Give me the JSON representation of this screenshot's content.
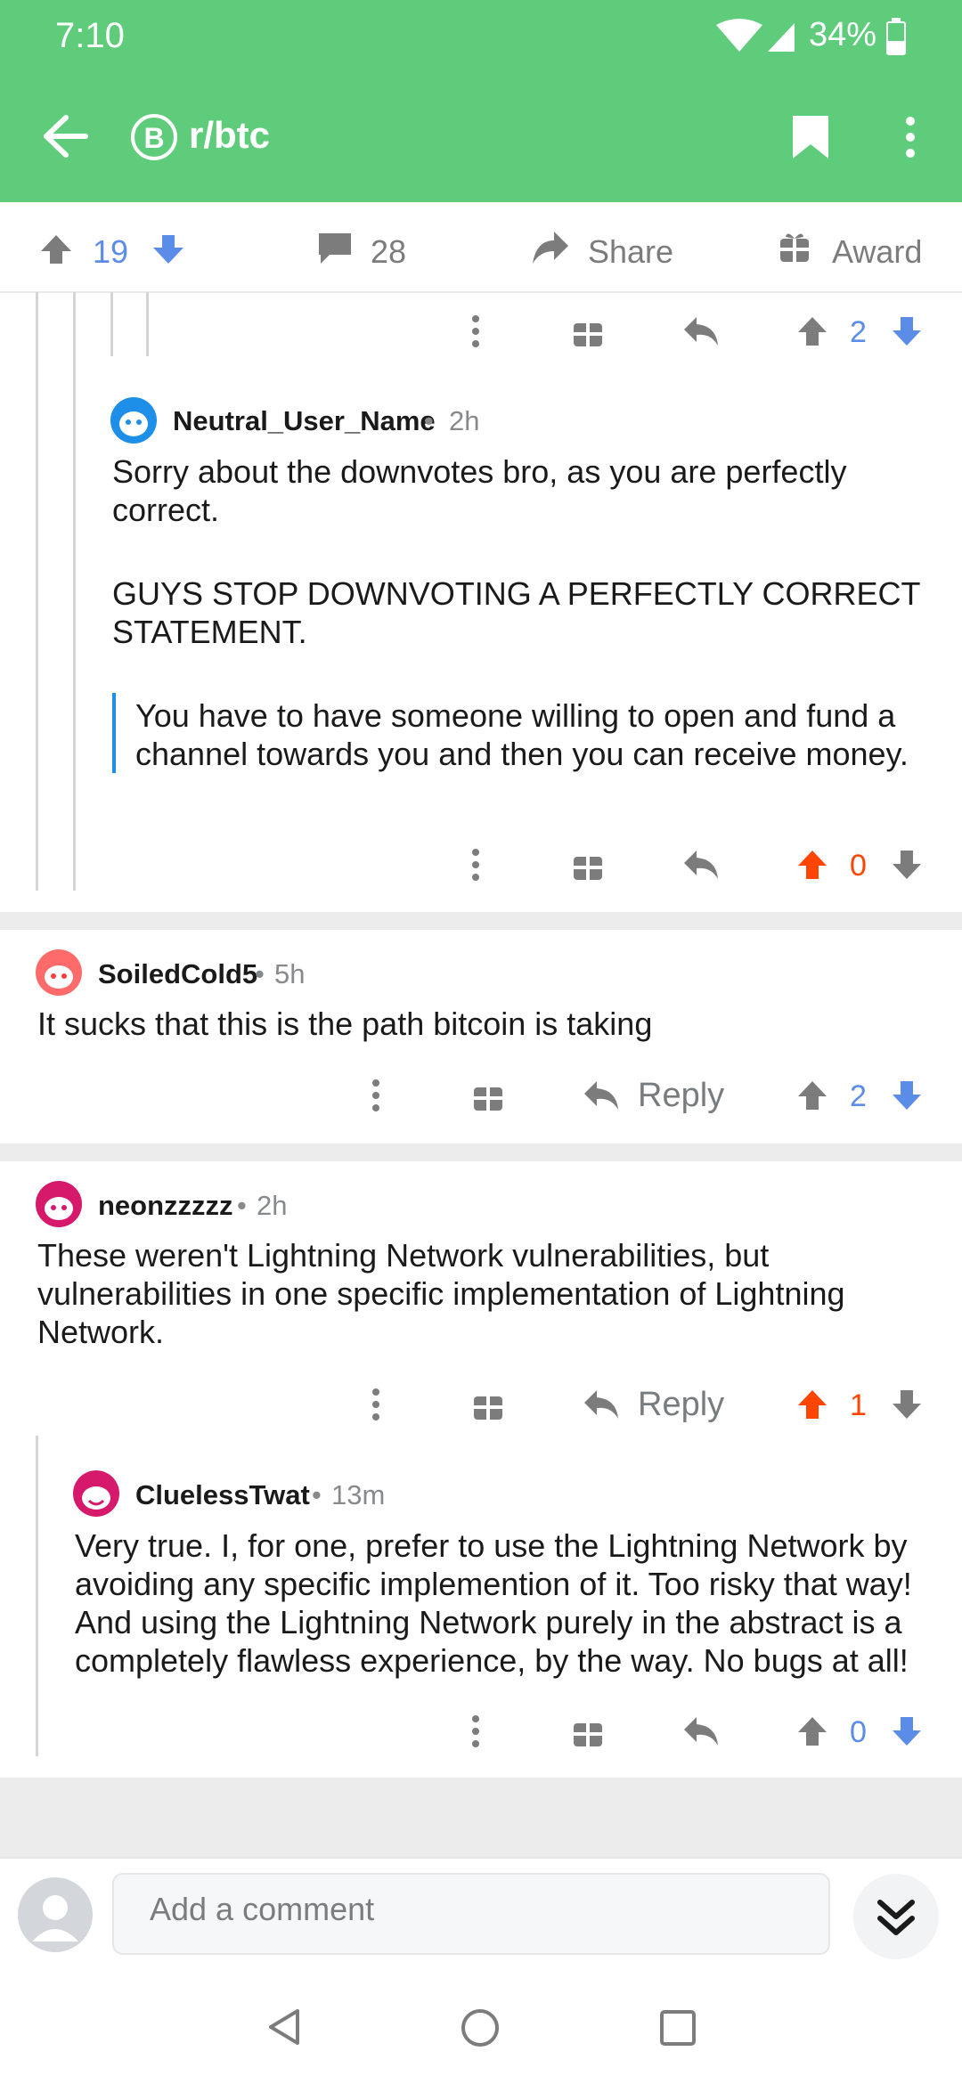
{
  "status": {
    "time": "7:10",
    "battery": "34%"
  },
  "header": {
    "subreddit": "r/btc",
    "subreddit_icon": "bitcoin-icon"
  },
  "votebar": {
    "upvotes": "19",
    "comments": "28",
    "share": "Share",
    "award": "Award"
  },
  "comments": [
    {
      "vote_count": "2"
    },
    {
      "author": "Neutral_User_Name",
      "age": "2h",
      "body_lines": [
        "Sorry about the downvotes bro, as you are perfectly",
        "correct."
      ],
      "body_lines2": [
        "GUYS STOP DOWNVOTING A PERFECTLY CORRECT",
        "STATEMENT."
      ],
      "quote_lines": [
        "You have to have someone willing to open and fund a",
        "channel towards you and then you can receive money."
      ],
      "vote_count": "0"
    },
    {
      "author": "SoiledCold5",
      "age": "5h",
      "body_lines": [
        "It sucks that this is the path bitcoin is taking"
      ],
      "reply": "Reply",
      "vote_count": "2"
    },
    {
      "author": "neonzzzzz",
      "age": "2h",
      "body_lines": [
        "These weren't Lightning Network vulnerabilities, but",
        "vulnerabilities in one specific implementation of Lightning",
        "Network."
      ],
      "reply": "Reply",
      "vote_count": "1"
    },
    {
      "author": "CluelessTwat",
      "age": "13m",
      "body_lines": [
        "Very true. I, for one, prefer to use the Lightning Network by",
        "avoiding any specific implemention of it. Too risky that way!",
        "And using the Lightning Network purely in the abstract is a",
        "completely flawless experience, by the way. No bugs at all!"
      ],
      "vote_count": "0"
    }
  ],
  "composer": {
    "placeholder": "Add a comment"
  },
  "colors": {
    "header_green": "#5fcc7c",
    "upvote_orange": "#ff4500",
    "downvote_blue": "#5b8ce8"
  }
}
